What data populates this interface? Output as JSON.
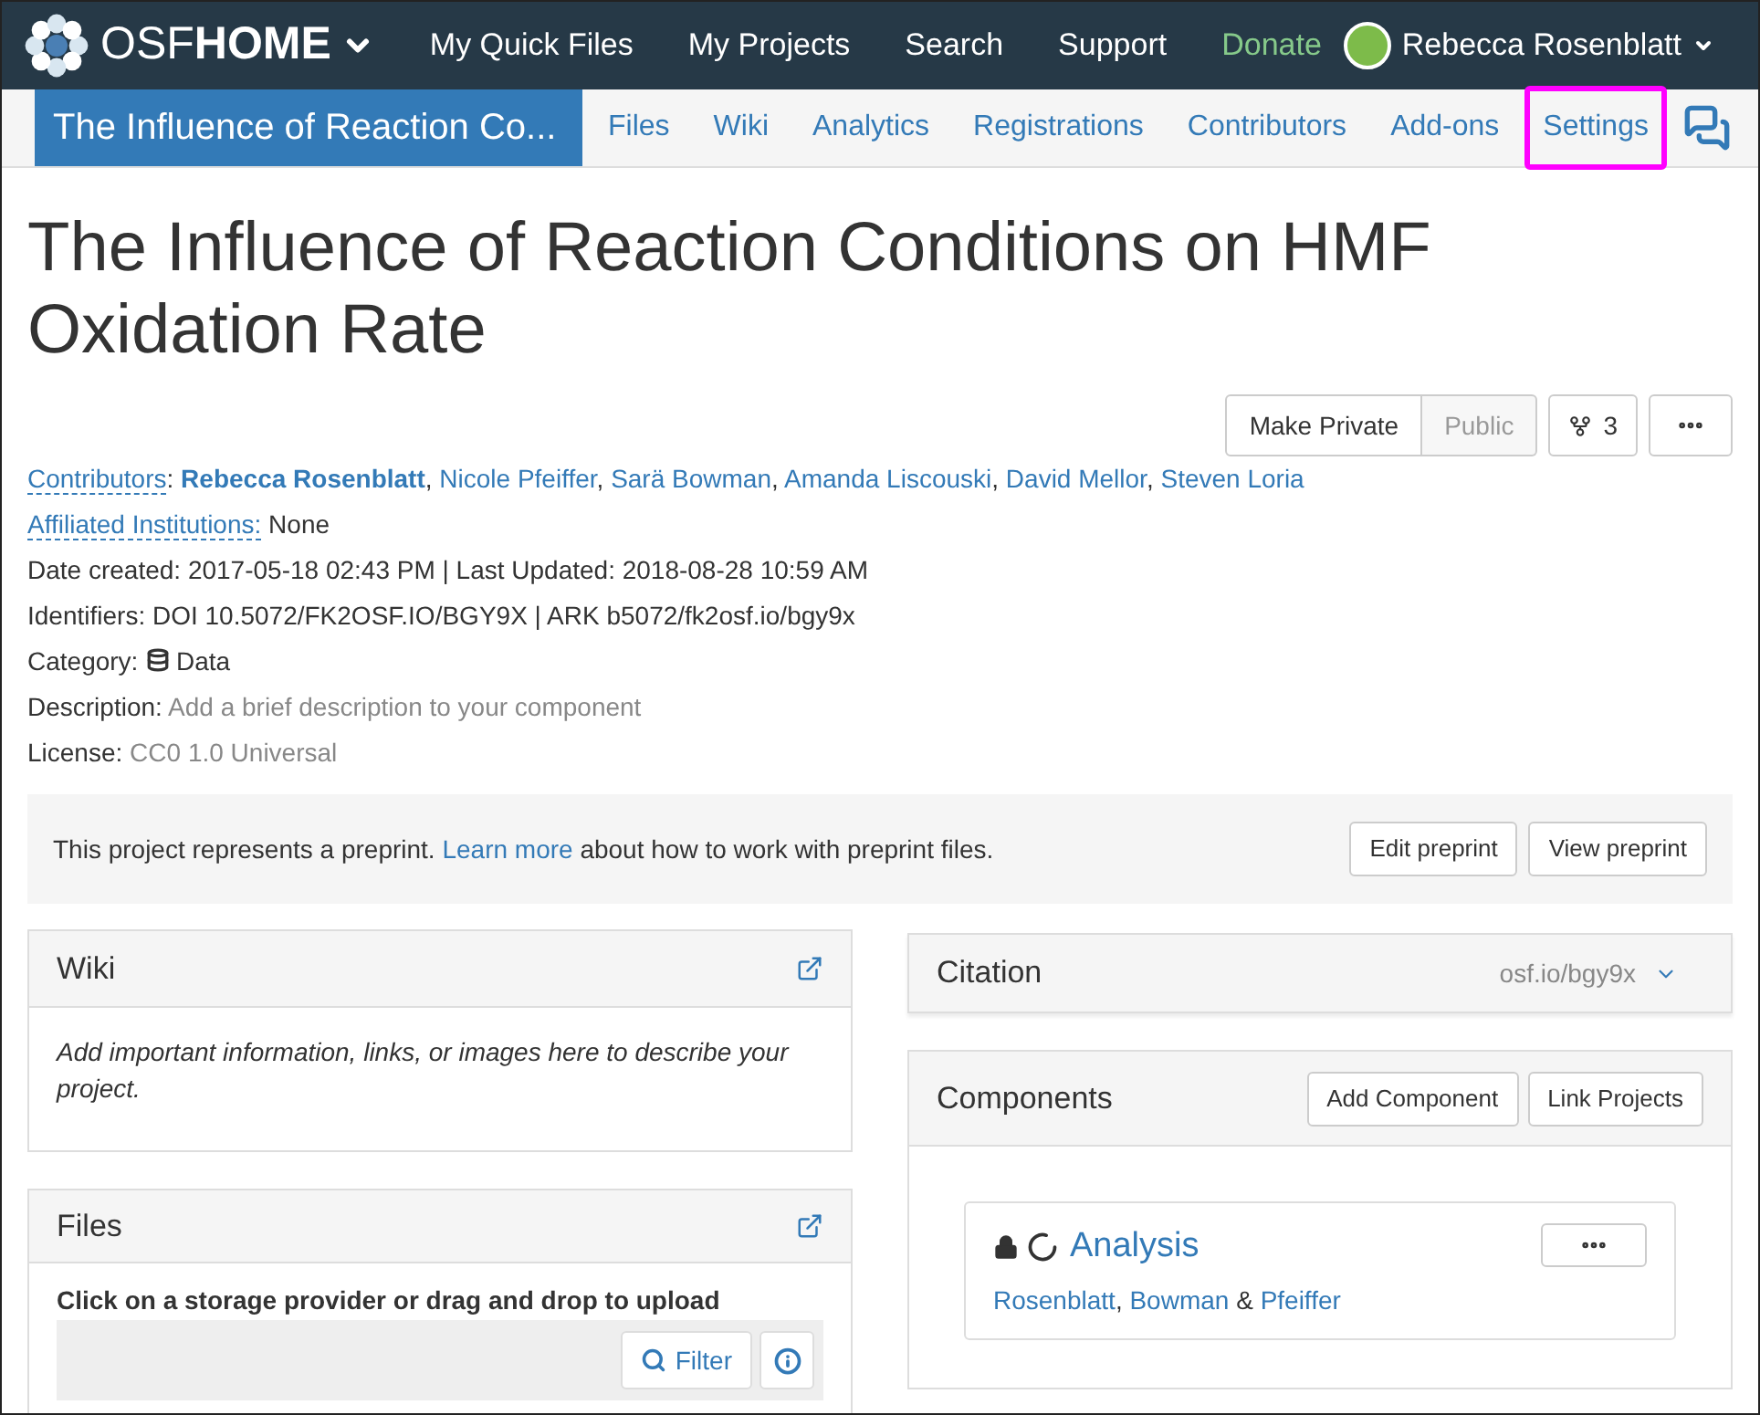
{
  "navbar": {
    "brand_light": "OSF",
    "brand_bold": "HOME",
    "links": [
      {
        "label": "My Quick Files",
        "kind": "link"
      },
      {
        "label": "My Projects",
        "kind": "link"
      },
      {
        "label": "Search",
        "kind": "link"
      },
      {
        "label": "Support",
        "kind": "link"
      },
      {
        "label": "Donate",
        "kind": "donate"
      }
    ],
    "user": "Rebecca Rosenblatt"
  },
  "project_nav": {
    "title": "The Influence of Reaction Co...",
    "tabs": [
      {
        "label": "Files",
        "highlighted": false
      },
      {
        "label": "Wiki",
        "highlighted": false
      },
      {
        "label": "Analytics",
        "highlighted": false
      },
      {
        "label": "Registrations",
        "highlighted": false
      },
      {
        "label": "Contributors",
        "highlighted": false
      },
      {
        "label": "Add-ons",
        "highlighted": false
      },
      {
        "label": "Settings",
        "highlighted": true
      }
    ]
  },
  "title": "The Influence of Reaction Conditions on HMF Oxidation Rate",
  "actions": {
    "make_private": "Make Private",
    "public": {
      "label": "Public",
      "disabled": true
    },
    "forks": "3"
  },
  "meta": [
    [
      {
        "kind": "label-link",
        "text": "Contributors"
      },
      {
        "kind": "plain",
        "text": ": "
      },
      {
        "kind": "link-bold",
        "text": "Rebecca Rosenblatt"
      },
      {
        "kind": "plain",
        "text": ", "
      },
      {
        "kind": "link",
        "text": "Nicole Pfeiffer"
      },
      {
        "kind": "plain",
        "text": ", "
      },
      {
        "kind": "link",
        "text": "Sarä Bowman"
      },
      {
        "kind": "plain",
        "text": ", "
      },
      {
        "kind": "link",
        "text": "Amanda Liscouski"
      },
      {
        "kind": "plain",
        "text": ", "
      },
      {
        "kind": "link",
        "text": "David Mellor"
      },
      {
        "kind": "plain",
        "text": ", "
      },
      {
        "kind": "link",
        "text": "Steven Loria"
      }
    ],
    [
      {
        "kind": "label-link",
        "text": "Affiliated Institutions:"
      },
      {
        "kind": "plain",
        "text": " None"
      }
    ],
    [
      {
        "kind": "plain",
        "text": "Date created: 2017-05-18 02:43 PM | Last Updated: 2018-08-28 10:59 AM"
      }
    ],
    [
      {
        "kind": "plain",
        "text": "Identifiers: DOI 10.5072/FK2OSF.IO/BGY9X | ARK b5072/fk2osf.io/bgy9x"
      }
    ],
    [
      {
        "kind": "plain",
        "text": "Category: "
      },
      {
        "kind": "icon"
      },
      {
        "kind": "plain",
        "text": " Data"
      }
    ],
    [
      {
        "kind": "plain",
        "text": "Description: "
      },
      {
        "kind": "muted",
        "text": "Add a brief description to your component"
      }
    ],
    [
      {
        "kind": "plain",
        "text": "License: "
      },
      {
        "kind": "muted",
        "text": "CC0 1.0 Universal"
      }
    ]
  ],
  "preprint_banner": {
    "segments": [
      {
        "kind": "plain",
        "text": "This project represents a preprint. "
      },
      {
        "kind": "link",
        "text": "Learn more"
      },
      {
        "kind": "plain",
        "text": " about how to work with preprint files."
      }
    ],
    "buttons": [
      "Edit preprint",
      "View preprint"
    ]
  },
  "wiki": {
    "title": "Wiki",
    "body": "Add important information, links, or images here to describe your project."
  },
  "files": {
    "title": "Files",
    "hint": "Click on a storage provider or drag and drop to upload",
    "filter": "Filter"
  },
  "citation": {
    "title": "Citation",
    "link": "osf.io/bgy9x"
  },
  "components": {
    "title": "Components",
    "buttons": [
      "Add Component",
      "Link Projects"
    ],
    "items": [
      {
        "title": "Analysis",
        "private": true,
        "authors": [
          {
            "name": "Rosenblatt",
            "after": ", "
          },
          {
            "name": "Bowman",
            "after": " & "
          },
          {
            "name": "Pfeiffer"
          }
        ]
      }
    ]
  }
}
